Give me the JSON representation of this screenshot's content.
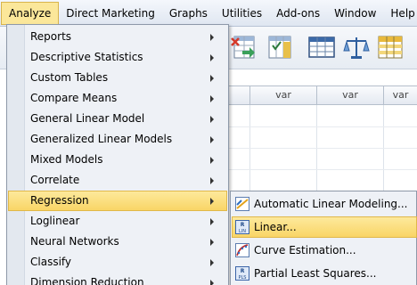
{
  "menubar": {
    "items": [
      {
        "label": "Analyze",
        "active": true
      },
      {
        "label": "Direct Marketing"
      },
      {
        "label": "Graphs"
      },
      {
        "label": "Utilities"
      },
      {
        "label": "Add-ons"
      },
      {
        "label": "Window"
      },
      {
        "label": "Help"
      }
    ]
  },
  "toolbar": {
    "icons": [
      "split-file-icon",
      "select-cases-icon",
      "data-view-icon",
      "value-labels-icon",
      "use-sets-icon"
    ]
  },
  "grid": {
    "column_headers": [
      "var",
      "var",
      "var"
    ]
  },
  "analyze_menu": {
    "items": [
      {
        "label": "Reports"
      },
      {
        "label": "Descriptive Statistics"
      },
      {
        "label": "Custom Tables"
      },
      {
        "label": "Compare Means"
      },
      {
        "label": "General Linear Model"
      },
      {
        "label": "Generalized Linear Models"
      },
      {
        "label": "Mixed Models"
      },
      {
        "label": "Correlate"
      },
      {
        "label": "Regression",
        "highlighted": true
      },
      {
        "label": "Loglinear"
      },
      {
        "label": "Neural Networks"
      },
      {
        "label": "Classify"
      },
      {
        "label": "Dimension Reduction"
      }
    ]
  },
  "regression_submenu": {
    "items": [
      {
        "label": "Automatic Linear Modeling...",
        "icon": "automatic-linear-modeling-icon"
      },
      {
        "label": "Linear...",
        "icon": "linear-regression-icon",
        "highlighted": true
      },
      {
        "label": "Curve Estimation...",
        "icon": "curve-estimation-icon"
      },
      {
        "label": "Partial Least Squares...",
        "icon": "partial-least-squares-icon"
      }
    ]
  },
  "colors": {
    "highlight": "#f9d566",
    "menu_background": "#eef1f6",
    "menubar_background": "#dfe6f1"
  }
}
